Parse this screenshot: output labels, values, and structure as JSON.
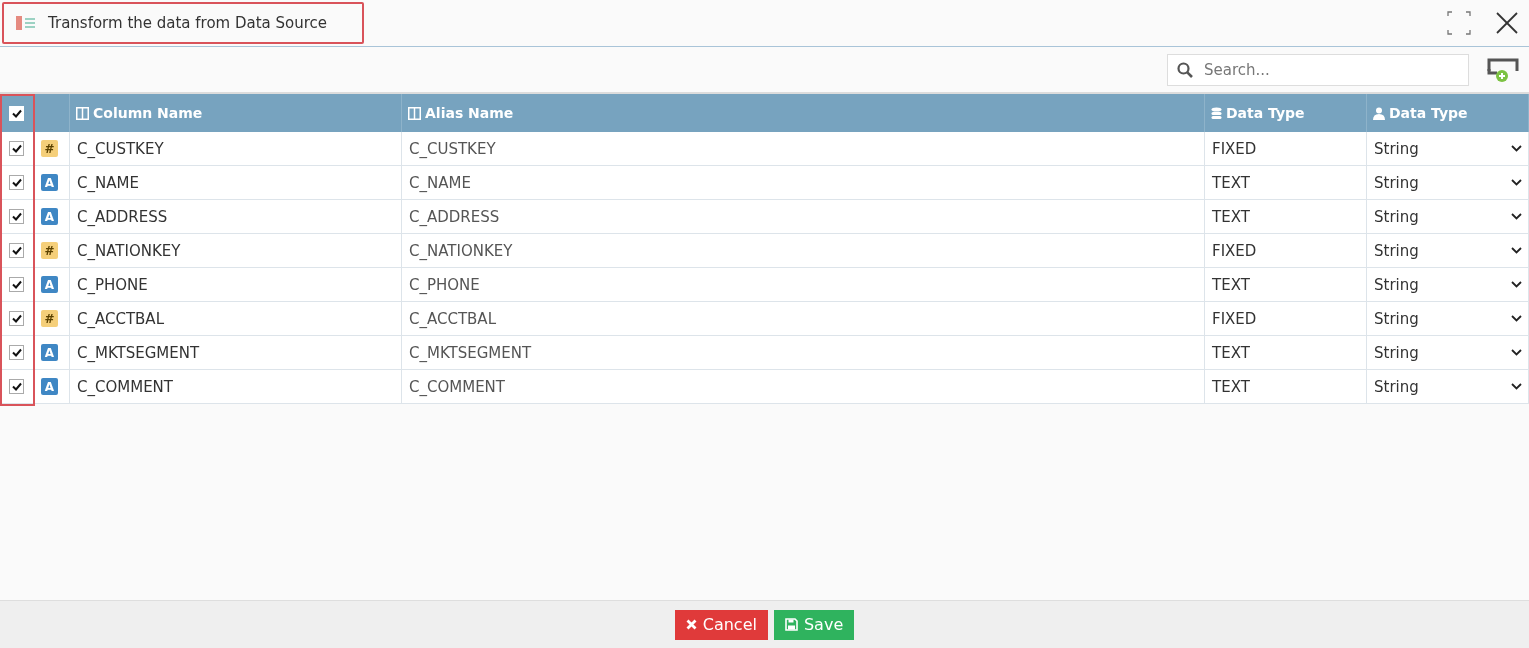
{
  "window": {
    "title": "Transform the data from Data Source"
  },
  "search": {
    "placeholder": "Search..."
  },
  "table": {
    "all_checked": true,
    "columns": [
      "Column Name",
      "Alias Name",
      "Data Type",
      "Data Type"
    ],
    "rows": [
      {
        "checked": true,
        "kind": "number",
        "icon": "#",
        "column_name": "C_CUSTKEY",
        "alias_name": "C_CUSTKEY",
        "data_type": "FIXED",
        "user_data_type": "String"
      },
      {
        "checked": true,
        "kind": "text",
        "icon": "A",
        "column_name": "C_NAME",
        "alias_name": "C_NAME",
        "data_type": "TEXT",
        "user_data_type": "String"
      },
      {
        "checked": true,
        "kind": "text",
        "icon": "A",
        "column_name": "C_ADDRESS",
        "alias_name": "C_ADDRESS",
        "data_type": "TEXT",
        "user_data_type": "String"
      },
      {
        "checked": true,
        "kind": "number",
        "icon": "#",
        "column_name": "C_NATIONKEY",
        "alias_name": "C_NATIONKEY",
        "data_type": "FIXED",
        "user_data_type": "String"
      },
      {
        "checked": true,
        "kind": "text",
        "icon": "A",
        "column_name": "C_PHONE",
        "alias_name": "C_PHONE",
        "data_type": "TEXT",
        "user_data_type": "String"
      },
      {
        "checked": true,
        "kind": "number",
        "icon": "#",
        "column_name": "C_ACCTBAL",
        "alias_name": "C_ACCTBAL",
        "data_type": "FIXED",
        "user_data_type": "String"
      },
      {
        "checked": true,
        "kind": "text",
        "icon": "A",
        "column_name": "C_MKTSEGMENT",
        "alias_name": "C_MKTSEGMENT",
        "data_type": "TEXT",
        "user_data_type": "String"
      },
      {
        "checked": true,
        "kind": "text",
        "icon": "A",
        "column_name": "C_COMMENT",
        "alias_name": "C_COMMENT",
        "data_type": "TEXT",
        "user_data_type": "String"
      }
    ]
  },
  "buttons": [
    {
      "kind": "cancel",
      "label": "Cancel"
    },
    {
      "kind": "save",
      "label": "Save"
    }
  ]
}
